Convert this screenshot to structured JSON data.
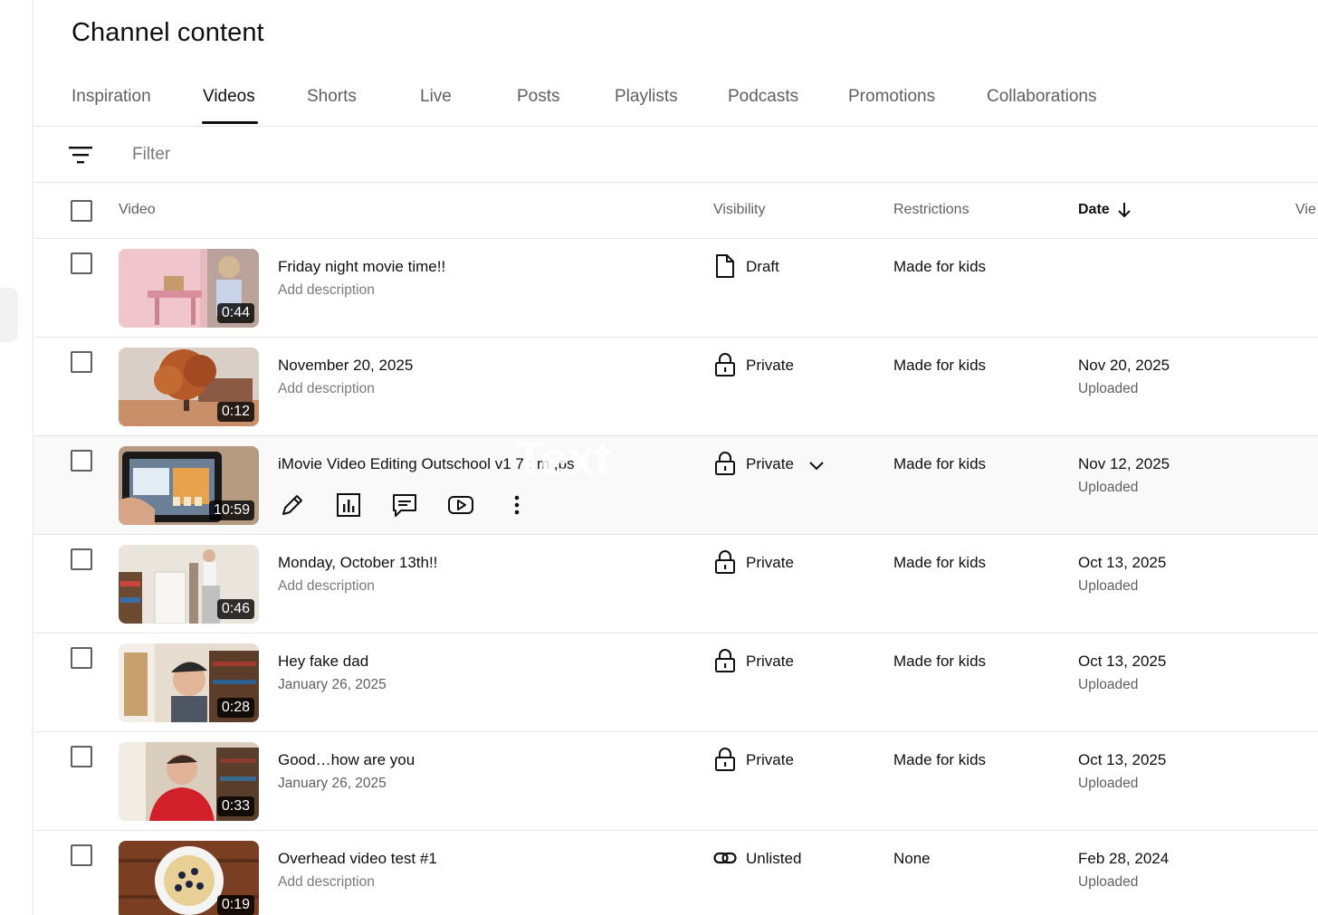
{
  "page_title": "Channel content",
  "tabs": [
    {
      "label": "Inspiration",
      "active": false
    },
    {
      "label": "Videos",
      "active": true
    },
    {
      "label": "Shorts",
      "active": false
    },
    {
      "label": "Live",
      "active": false
    },
    {
      "label": "Posts",
      "active": false
    },
    {
      "label": "Playlists",
      "active": false
    },
    {
      "label": "Podcasts",
      "active": false
    },
    {
      "label": "Promotions",
      "active": false
    },
    {
      "label": "Collaborations",
      "active": false
    }
  ],
  "filter": {
    "placeholder": "Filter",
    "icon": "filter-lines-icon"
  },
  "columns": {
    "video": "Video",
    "visibility": "Visibility",
    "restrictions": "Restrictions",
    "date": "Date",
    "views": "Vie",
    "date_sort": "descending"
  },
  "rows": [
    {
      "title": "Friday night movie time!!",
      "description": "Add description",
      "duration": "0:44",
      "visibility": "Draft",
      "visibility_icon": "draft-file-icon",
      "restrictions": "Made for kids",
      "date": "",
      "date_status": ""
    },
    {
      "title": "November 20, 2025",
      "description": "Add description",
      "duration": "0:12",
      "visibility": "Private",
      "visibility_icon": "lock-icon",
      "restrictions": "Made for kids",
      "date": "Nov 20, 2025",
      "date_status": "Uploaded"
    },
    {
      "title": "iMovie Video Editing Outschool v1 7 : m  ,ps",
      "watermark": "Text",
      "duration": "10:59",
      "visibility": "Private",
      "visibility_icon": "lock-icon",
      "restrictions": "Made for kids",
      "date": "Nov 12, 2025",
      "date_status": "Uploaded",
      "hovered": true
    },
    {
      "title": "Monday, October 13th!!",
      "description": "Add description",
      "duration": "0:46",
      "visibility": "Private",
      "visibility_icon": "lock-icon",
      "restrictions": "Made for kids",
      "date": "Oct 13, 2025",
      "date_status": "Uploaded"
    },
    {
      "title": "Hey fake dad",
      "description": "January 26, 2025",
      "duration": "0:28",
      "visibility": "Private",
      "visibility_icon": "lock-icon",
      "restrictions": "Made for kids",
      "date": "Oct 13, 2025",
      "date_status": "Uploaded"
    },
    {
      "title": "Good…how are you",
      "description": "January 26, 2025",
      "duration": "0:33",
      "visibility": "Private",
      "visibility_icon": "lock-icon",
      "restrictions": "Made for kids",
      "date": "Oct 13, 2025",
      "date_status": "Uploaded"
    },
    {
      "title": "Overhead video test #1",
      "description": "Add description",
      "duration": "0:19",
      "visibility": "Unlisted",
      "visibility_icon": "link-icon",
      "restrictions": "None",
      "date": "Feb 28, 2024",
      "date_status": "Uploaded"
    }
  ],
  "row_actions": [
    "pencil-icon",
    "analytics-icon",
    "comments-icon",
    "youtube-play-icon",
    "more-vert-icon"
  ],
  "colors": {
    "accent": "#0f0f0f",
    "secondary_text": "#606060",
    "divider": "#e5e5e5",
    "hover_row": "#f9f9f9"
  }
}
